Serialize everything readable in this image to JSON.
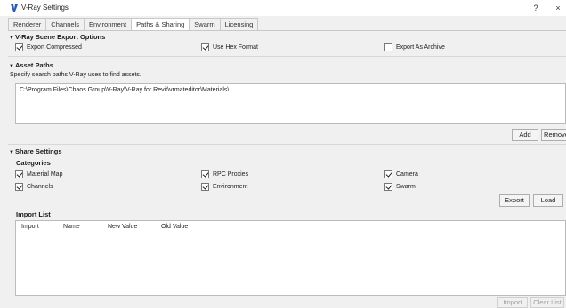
{
  "window": {
    "title": "V-Ray Settings",
    "help": "?",
    "close": "×"
  },
  "tabs": [
    {
      "label": "Renderer",
      "active": false
    },
    {
      "label": "Channels",
      "active": false
    },
    {
      "label": "Environment",
      "active": false
    },
    {
      "label": "Paths & Sharing",
      "active": true
    },
    {
      "label": "Swarm",
      "active": false
    },
    {
      "label": "Licensing",
      "active": false
    }
  ],
  "scene_export": {
    "heading": "V-Ray Scene Export Options",
    "export_compressed": {
      "label": "Export Compressed",
      "checked": true
    },
    "use_hex": {
      "label": "Use Hex Format",
      "checked": true
    },
    "export_archive": {
      "label": "Export As Archive",
      "checked": false
    }
  },
  "asset_paths": {
    "heading": "Asset Paths",
    "description": "Specify search paths V-Ray uses to find assets.",
    "paths": [
      "C:\\Program Files\\Chaos Group\\V-Ray\\V-Ray for Revit\\vrmateditor\\Materials\\"
    ],
    "add_label": "Add",
    "remove_label": "Remove"
  },
  "share_settings": {
    "heading": "Share Settings",
    "categories_heading": "Categories",
    "categories": {
      "material_map": {
        "label": "Material Map",
        "checked": true
      },
      "rpc_proxies": {
        "label": "RPC Proxies",
        "checked": true
      },
      "camera": {
        "label": "Camera",
        "checked": true
      },
      "channels": {
        "label": "Channels",
        "checked": true
      },
      "environment": {
        "label": "Environment",
        "checked": true
      },
      "swarm": {
        "label": "Swarm",
        "checked": true
      }
    },
    "export_label": "Export",
    "load_label": "Load"
  },
  "import_list": {
    "heading": "Import List",
    "columns": [
      "Import",
      "Name",
      "New Value",
      "Old Value"
    ],
    "import_label": "Import",
    "clear_label": "Clear List"
  },
  "colors": {
    "icon_blue": "#2a5db0",
    "checkbox_border": "#777777",
    "disabled_text": "#a0a0a0"
  }
}
